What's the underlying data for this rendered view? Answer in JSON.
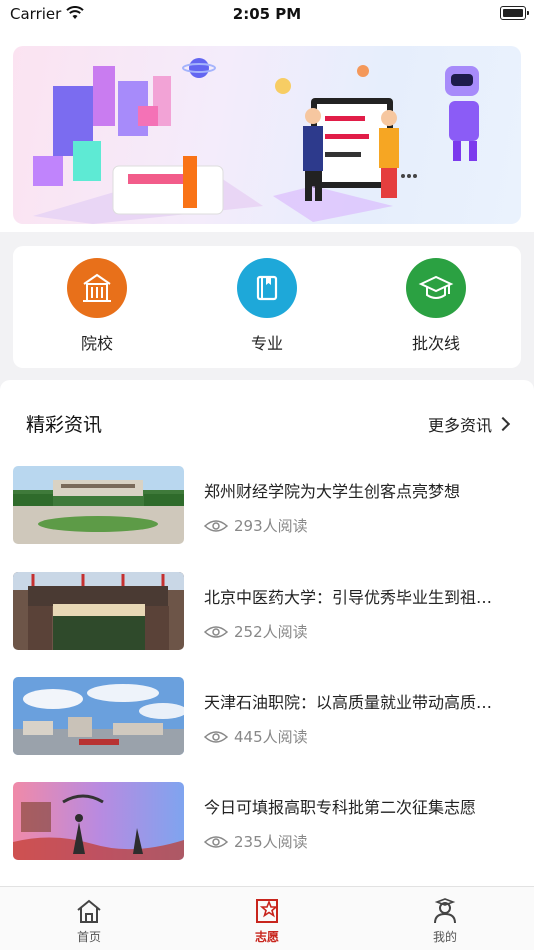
{
  "status_bar": {
    "carrier": "Carrier",
    "time": "2:05 PM"
  },
  "quick_links": [
    {
      "label": "院校",
      "icon": "school-building-icon",
      "color": "#e8701a"
    },
    {
      "label": "专业",
      "icon": "book-icon",
      "color": "#1ea8d9"
    },
    {
      "label": "批次线",
      "icon": "graduation-cap-icon",
      "color": "#2ba142"
    }
  ],
  "news": {
    "title": "精彩资讯",
    "more_label": "更多资讯",
    "items": [
      {
        "headline": "郑州财经学院为大学生创客点亮梦想",
        "reads": "293人阅读"
      },
      {
        "headline": "北京中医药大学：引导优秀毕业生到祖国最需要的地方",
        "reads": "252人阅读"
      },
      {
        "headline": "天津石油职院：以高质量就业带动高质量发展",
        "reads": "445人阅读"
      },
      {
        "headline": "今日可填报高职专科批第二次征集志愿",
        "reads": "235人阅读"
      }
    ]
  },
  "tabbar": {
    "tabs": [
      {
        "label": "首页",
        "icon": "home-icon"
      },
      {
        "label": "志愿",
        "icon": "star-document-icon",
        "active": true
      },
      {
        "label": "我的",
        "icon": "user-graduate-icon"
      }
    ],
    "active_color": "#c8251d"
  }
}
